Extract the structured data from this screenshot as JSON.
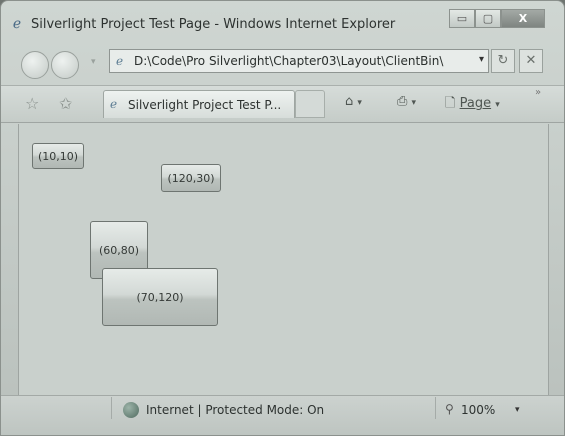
{
  "window": {
    "title": "Silverlight Project Test Page - Windows Internet Explorer",
    "minimize_glyph": "▭",
    "maximize_glyph": "▢",
    "close_glyph": "X"
  },
  "navigation": {
    "back_glyph": "",
    "forward_glyph": "",
    "address": "D:\\Code\\Pro Silverlight\\Chapter03\\Layout\\ClientBin\\",
    "refresh_glyph": "↻",
    "stop_glyph": "✕"
  },
  "tabs": [
    {
      "label": "Silverlight Project Test P..."
    }
  ],
  "command_bar": {
    "home_glyph": "⌂",
    "print_glyph": "⎙",
    "page_label": "Page",
    "more_glyph": "»"
  },
  "content": {
    "buttons": [
      {
        "label": "(10,10)"
      },
      {
        "label": "(120,30)"
      },
      {
        "label": "(60,80)"
      },
      {
        "label": "(70,120)"
      }
    ]
  },
  "status": {
    "zone_text": "Internet | Protected Mode: On",
    "zoom": "100%"
  },
  "icons": {
    "app": "internet-explorer-icon",
    "page": "page-icon",
    "globe": "globe-icon",
    "favorites_star": "favorites-star-icon",
    "add_favorites": "add-favorites-icon"
  }
}
